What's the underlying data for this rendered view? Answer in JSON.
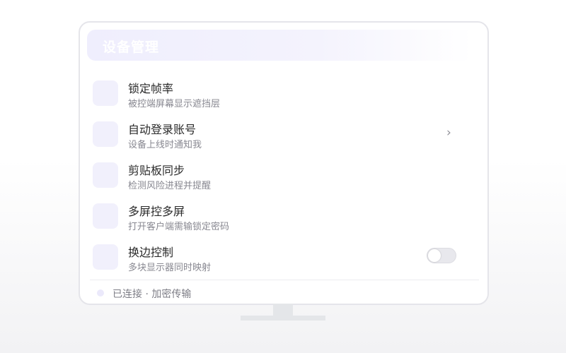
{
  "title": "设备管理",
  "items": [
    {
      "title": "锁定帧率",
      "subtitle": "被控端屏幕显示遮挡层",
      "icon": "blank-icon"
    },
    {
      "title": "自动登录账号",
      "subtitle": "设备上线时通知我",
      "icon": "blank-icon",
      "trailing": "›"
    },
    {
      "title": "剪贴板同步",
      "subtitle": "检测风险进程并提醒",
      "icon": "blank-icon"
    },
    {
      "title": "多屏控多屏",
      "subtitle": "打开客户端需输锁定密码",
      "icon": "blank-icon"
    },
    {
      "title": "换边控制",
      "subtitle": "多块显示器同时映射",
      "icon": "blank-icon",
      "toggle": false
    }
  ],
  "status": {
    "text": "已连接 · 加密传输"
  },
  "colors": {
    "accent": "#efeefd",
    "icon_bg": "#f1f0fc",
    "text": "#2a2a2a",
    "subtext": "#888891"
  }
}
